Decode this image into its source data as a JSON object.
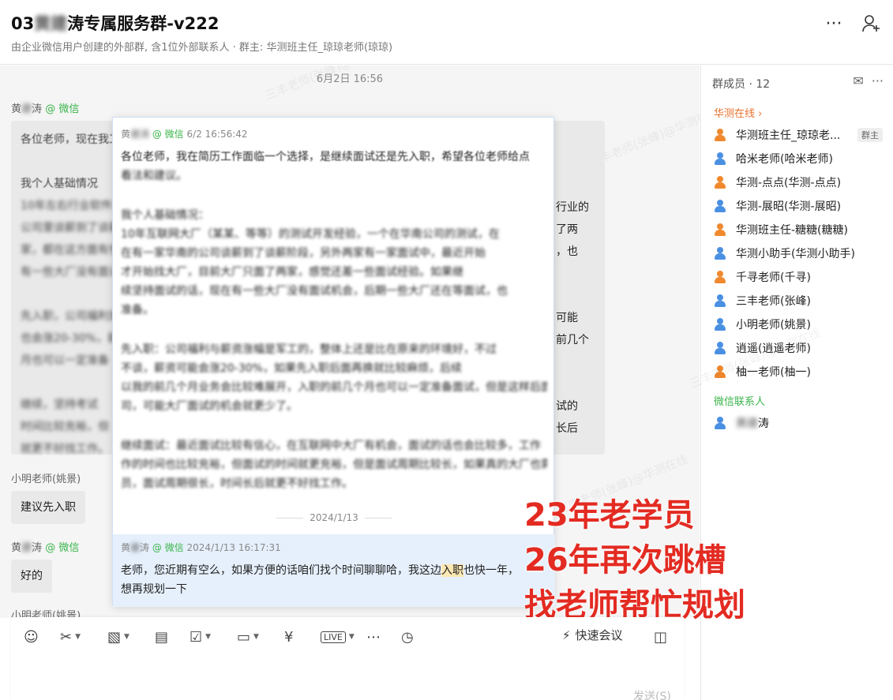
{
  "header": {
    "title_prefix": "03",
    "title_blurred": "黄建",
    "title_suffix": "涛专属服务群-v222",
    "subtitle": "由企业微信用户创建的外部群, 含1位外部联系人 · 群主: 华测班主任_琼琼老师(琼琼)",
    "more_icon": "more-icon",
    "add_member_icon": "add-member-icon"
  },
  "chat": {
    "date": "6月2日 16:56",
    "msg1": {
      "sender_prefix": "黄",
      "sender_blur": "建",
      "sender_suffix": "涛",
      "sender_tag": "@ 微信",
      "lines": [
        "各位老师，现在我工作面临",
        "",
        "我个人基础情况",
        "10年左右行业软件测试在公",
        "公司里谈薪到了谈薪了两",
        "家，都在这方面有些还",
        "有一些大厂没有面试机",
        "",
        "先入职，公司福利是领",
        "也会涨20-30%，前",
        "月也可以一定准备",
        "",
        "继续，坚持考试",
        "时间比较充裕，但",
        "就更不好找工作。"
      ],
      "right_lines": [
        "行业的",
        "了两",
        "，也",
        "可能",
        "前几个",
        "试的",
        "长后"
      ]
    },
    "msg2": {
      "sender": "小明老师(姚景)",
      "text": "建议先入职"
    },
    "msg3": {
      "sender_prefix": "黄",
      "sender_blur": "建",
      "sender_suffix": "涛",
      "sender_tag": "@ 微信",
      "text": "好的"
    },
    "msg4": {
      "sender": "小明老师(姚景)"
    }
  },
  "popup": {
    "meta1": {
      "prefix": "黄",
      "blur": "建涛",
      "tag": "@ 微信",
      "time": "6/2 16:56:42"
    },
    "para1": [
      "各位老师，我在简历工作面临一个选择，是继续面试还是先入职，希望各位老师给点",
      "看法和建议。"
    ],
    "para2": [
      "我个人基础情况：",
      "10年互联网大厂（某某、等等）的测试开发经验，一个在华南公司的测试，在",
      "在有一家华南的公司谈薪到了谈薪阶段，另外两家有一家面试中，最近开始",
      "才开始找大厂，目前大厂只面了两家，感觉还差一些面试经验。如果继",
      "续坚持面试的话，现在有一些大厂没有面试机会，后期一些大厂还在等面试，也",
      "准备。"
    ],
    "para3": [
      "先入职：公司福利与薪资涨幅是军工的，整体上还是比在原来的环境好，不过",
      "不谈，薪资可能会涨20-30%，如果先入职后面再换就比较麻烦，后续",
      "以我的前几个月业务会比较难展开，入职的前几个月也可以一定准备面试，但是这样后面入职了大厂的公",
      "司，可能大厂面试的机会就更少了。"
    ],
    "para4": [
      "继续面试：最近面试比较有信心，在互联网中大厂有机会，面试的话也会比较多，工作",
      "作的时间也比较充裕，但面试的时间就更充裕，但是面试周期比较长，如果真的大厂也需要",
      "员，面试周期很长，时间长后就更不好找工作。"
    ],
    "date2": "2024/1/13",
    "meta2": {
      "prefix": "黄",
      "blur": "建",
      "suffix": "涛",
      "tag": "@ 微信",
      "time": "2024/1/13 16:17:31"
    },
    "msg2_line1_a": "老师，您近期有空么，如果方便的话咱们找个时间聊聊哈，我这边",
    "msg2_line1_mark": "入职",
    "msg2_line1_b": "也快一年，",
    "msg2_line2": "想再规划一下"
  },
  "callouts": [
    "23年老学员",
    "26年再次跳槽",
    "找老师帮忙规划"
  ],
  "members": {
    "title": "群成员 · 12",
    "group1": "华测在线 ›",
    "group2": "微信联系人",
    "owner_badge": "群主",
    "list": [
      {
        "name": "华测班主任_琼琼老...",
        "color": "orange"
      },
      {
        "name": "哈米老师(哈米老师)",
        "color": "blue"
      },
      {
        "name": "华测-点点(华测-点点)",
        "color": "orange"
      },
      {
        "name": "华测-展昭(华测-展昭)",
        "color": "blue"
      },
      {
        "name": "华测班主任-糖糖(糖糖)",
        "color": "orange"
      },
      {
        "name": "华测小助手(华测小助手)",
        "color": "blue"
      },
      {
        "name": "千寻老师(千寻)",
        "color": "orange"
      },
      {
        "name": "三丰老师(张峰)",
        "color": "blue"
      },
      {
        "name": "小明老师(姚景)",
        "color": "blue"
      },
      {
        "name": "逍遥(逍遥老师)",
        "color": "blue"
      },
      {
        "name": "柚一老师(柚一)",
        "color": "orange"
      }
    ],
    "wx_contact_blur": "黄建",
    "wx_contact_suffix": "涛"
  },
  "composer": {
    "quick_meeting": "快速会议",
    "send": "发送(S)",
    "tools": [
      "emoji-icon",
      "scissors-icon",
      "image-icon",
      "doc-icon",
      "task-icon",
      "folder-icon",
      "yen-icon",
      "live-icon",
      "more-icon",
      "clock-icon"
    ]
  },
  "watermark": "三丰老师(张峰)@华测在线"
}
